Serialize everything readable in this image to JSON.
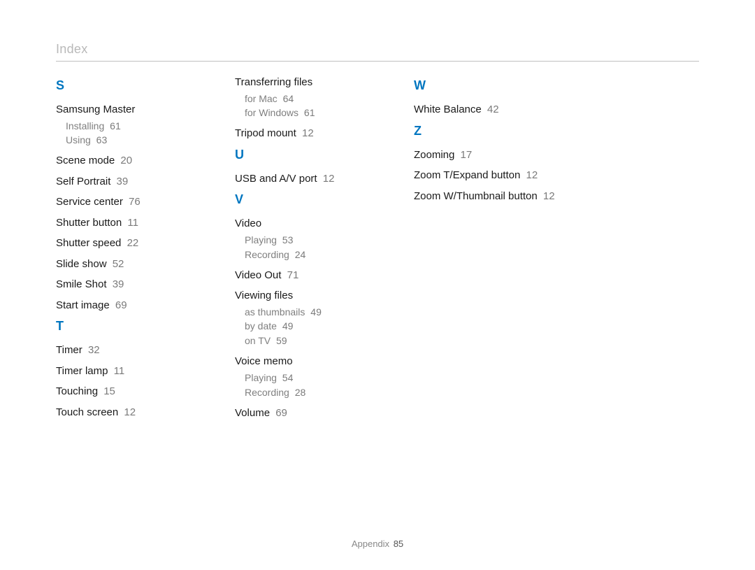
{
  "page_title": "Index",
  "footer": {
    "label": "Appendix",
    "page": "85"
  },
  "columns": [
    {
      "sections": [
        {
          "letter": "S",
          "entries": [
            {
              "label": "Samsung Master",
              "page": "",
              "subs": [
                {
                  "label": "Installing",
                  "page": "61"
                },
                {
                  "label": "Using",
                  "page": "63"
                }
              ]
            },
            {
              "label": "Scene mode",
              "page": "20"
            },
            {
              "label": "Self Portrait",
              "page": "39"
            },
            {
              "label": "Service center",
              "page": "76"
            },
            {
              "label": "Shutter button",
              "page": "11"
            },
            {
              "label": "Shutter speed",
              "page": "22"
            },
            {
              "label": "Slide show",
              "page": "52"
            },
            {
              "label": "Smile Shot",
              "page": "39"
            },
            {
              "label": "Start image",
              "page": "69"
            }
          ]
        },
        {
          "letter": "T",
          "entries": [
            {
              "label": "Timer",
              "page": "32"
            },
            {
              "label": "Timer lamp",
              "page": "11"
            },
            {
              "label": "Touching",
              "page": "15"
            },
            {
              "label": "Touch screen",
              "page": "12"
            }
          ]
        }
      ]
    },
    {
      "sections": [
        {
          "letter": "",
          "entries": [
            {
              "label": "Transferring ﬁles",
              "page": "",
              "subs": [
                {
                  "label": "for Mac",
                  "page": "64"
                },
                {
                  "label": "for Windows",
                  "page": "61"
                }
              ]
            },
            {
              "label": "Tripod mount",
              "page": "12"
            }
          ]
        },
        {
          "letter": "U",
          "entries": [
            {
              "label": "USB and A/V port",
              "page": "12"
            }
          ]
        },
        {
          "letter": "V",
          "entries": [
            {
              "label": "Video",
              "page": "",
              "subs": [
                {
                  "label": "Playing",
                  "page": "53"
                },
                {
                  "label": "Recording",
                  "page": "24"
                }
              ]
            },
            {
              "label": "Video Out",
              "page": "71"
            },
            {
              "label": "Viewing ﬁles",
              "page": "",
              "subs": [
                {
                  "label": "as thumbnails",
                  "page": "49"
                },
                {
                  "label": "by date",
                  "page": "49"
                },
                {
                  "label": "on TV",
                  "page": "59"
                }
              ]
            },
            {
              "label": "Voice memo",
              "page": "",
              "subs": [
                {
                  "label": "Playing",
                  "page": "54"
                },
                {
                  "label": "Recording",
                  "page": "28"
                }
              ]
            },
            {
              "label": "Volume",
              "page": "69"
            }
          ]
        }
      ]
    },
    {
      "sections": [
        {
          "letter": "W",
          "entries": [
            {
              "label": "White Balance",
              "page": "42"
            }
          ]
        },
        {
          "letter": "Z",
          "entries": [
            {
              "label": "Zooming",
              "page": "17"
            },
            {
              "label": "Zoom T/Expand button",
              "page": "12"
            },
            {
              "label": "Zoom W/Thumbnail button",
              "page": "12"
            }
          ]
        }
      ]
    }
  ]
}
